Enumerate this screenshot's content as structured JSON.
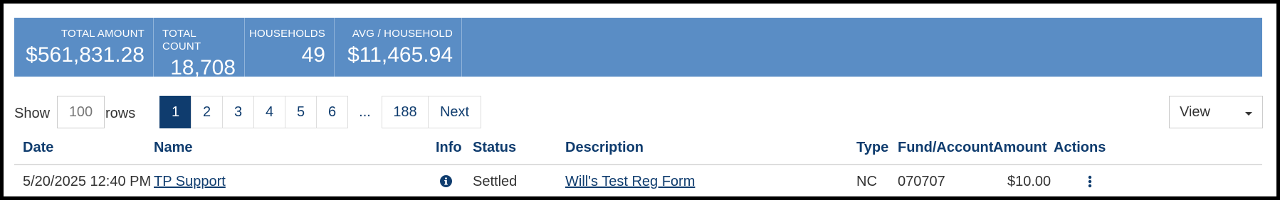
{
  "summary": {
    "stats": [
      {
        "label": "TOTAL AMOUNT",
        "value": "$561,831.28"
      },
      {
        "label": "TOTAL COUNT",
        "value": "18,708"
      },
      {
        "label": "HOUSEHOLDS",
        "value": "49"
      },
      {
        "label": "AVG / HOUSEHOLD",
        "value": "$11,465.94"
      }
    ]
  },
  "controls": {
    "show_label": "Show",
    "rows_value": "100",
    "rows_label": "rows",
    "pages": [
      "1",
      "2",
      "3",
      "4",
      "5",
      "6"
    ],
    "active_page": "1",
    "ellipsis": "...",
    "last_page": "188",
    "next_label": "Next",
    "view_label": "View"
  },
  "table": {
    "columns": {
      "date": "Date",
      "name": "Name",
      "info": "Info",
      "status": "Status",
      "description": "Description",
      "type": "Type",
      "fund": "Fund/Account",
      "amount": "Amount",
      "actions": "Actions"
    },
    "rows": [
      {
        "date": "5/20/2025 12:40 PM",
        "name": "TP Support",
        "info_icon": "info-circle-icon",
        "status": "Settled",
        "description": "Will's Test Reg Form",
        "type": "NC",
        "fund": "070707",
        "amount": "$10.00",
        "actions_icon": "kebab-menu-icon"
      }
    ]
  },
  "colors": {
    "stats_bg": "#5a8dc5",
    "primary": "#0f3c6e",
    "text": "#333333"
  }
}
